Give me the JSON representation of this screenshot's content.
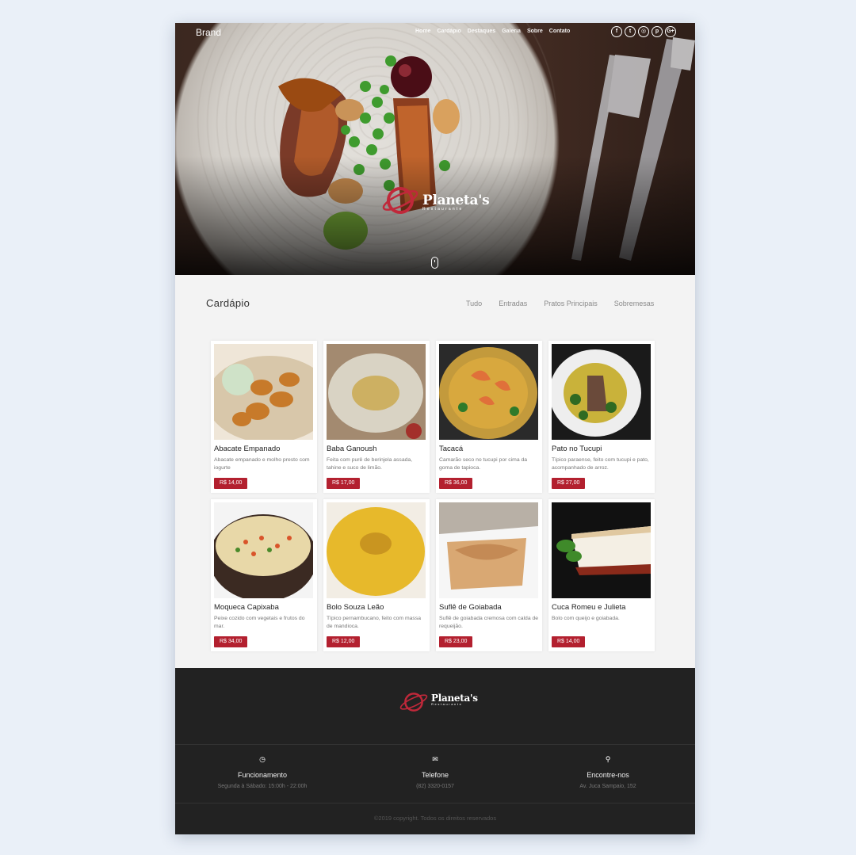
{
  "header": {
    "brand": "Brand",
    "nav": [
      "Home",
      "Cardápio",
      "Destaques",
      "Galeria",
      "Sobre",
      "Contato"
    ],
    "socials": [
      {
        "icon": "facebook-icon",
        "glyph": "f"
      },
      {
        "icon": "twitter-icon",
        "glyph": "t"
      },
      {
        "icon": "instagram-icon",
        "glyph": "◎"
      },
      {
        "icon": "pinterest-icon",
        "glyph": "p"
      },
      {
        "icon": "google-plus-icon",
        "glyph": "G+"
      }
    ]
  },
  "hero": {
    "logo_name": "Planeta's",
    "logo_sub": "Restaurante"
  },
  "menu": {
    "title": "Cardápio",
    "filters": [
      "Tudo",
      "Entradas",
      "Pratos Principais",
      "Sobremesas"
    ],
    "items": [
      {
        "name": "Abacate Empanado",
        "desc": "Abacate empanado e molho presto com iogurte",
        "price": "R$ 14,00"
      },
      {
        "name": "Baba Ganoush",
        "desc": "Feita com purê de berinjela assada, tahine e suco de limão.",
        "price": "R$ 17,00"
      },
      {
        "name": "Tacacá",
        "desc": "Camarão seco no tucupi por cima da goma de tapioca.",
        "price": "R$ 36,00"
      },
      {
        "name": "Pato no Tucupi",
        "desc": "Típico paraense, feito com tucupi e pato, acompanhado de arroz.",
        "price": "R$ 27,00"
      },
      {
        "name": "Moqueca Capixaba",
        "desc": "Peixe cozido com vegetais e frutos do mar.",
        "price": "R$ 34,00"
      },
      {
        "name": "Bolo Souza Leão",
        "desc": "Típico pernambucano, feito com massa de mandioca.",
        "price": "R$ 12,00"
      },
      {
        "name": "Suflê de Goiabada",
        "desc": "Suflê de goiabada cremosa com calda de requeijão.",
        "price": "R$ 23,00"
      },
      {
        "name": "Cuca Romeu e Julieta",
        "desc": "Bolo com queijo e goiabada.",
        "price": "R$ 14,00"
      }
    ]
  },
  "footer": {
    "logo_name": "Planeta's",
    "logo_sub": "Restaurante",
    "info": [
      {
        "icon": "clock-icon",
        "glyph": "◷",
        "title": "Funcionamento",
        "sub": "Segunda à Sábado: 15:00h - 22:00h"
      },
      {
        "icon": "chat-icon",
        "glyph": "✉",
        "title": "Telefone",
        "sub": "(82) 3320-0157"
      },
      {
        "icon": "pin-icon",
        "glyph": "⚲",
        "title": "Encontre-nos",
        "sub": "Av. Juca Sampaio, 152"
      }
    ],
    "copyright": "©2019 copyright. Todos os direitos reservados"
  }
}
